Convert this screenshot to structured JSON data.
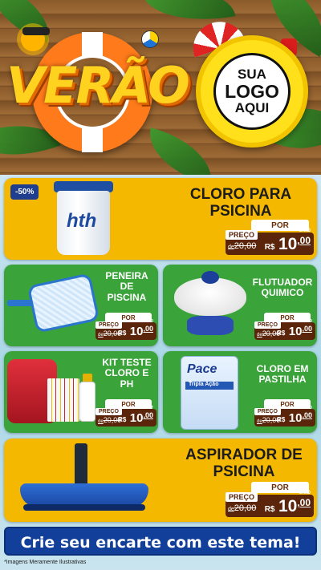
{
  "header": {
    "title": "VERÃO",
    "logo_line1": "SUA",
    "logo_line2": "LOGO",
    "logo_line3": "AQUI"
  },
  "products": [
    {
      "name_line1": "CLORO PARA",
      "name_line2": "PSICINA",
      "badge": "-50%",
      "por_label": "POR",
      "preco_label": "PREÇO",
      "old_prefix": "de",
      "old_price": "20,00",
      "currency": "R$",
      "price_int": "10",
      "price_dec": ",00",
      "unit": "UNID"
    },
    {
      "name_line1": "PENEIRA",
      "name_line2": "DE",
      "name_line3": "PISCINA",
      "por_label": "POR",
      "preco_label": "PREÇO",
      "old_prefix": "de",
      "old_price": "20,00",
      "currency": "R$",
      "price_int": "10",
      "price_dec": ",00",
      "unit": "UNID"
    },
    {
      "name_line1": "FLUTUADOR",
      "name_line2": "QUIMICO",
      "por_label": "POR",
      "preco_label": "PREÇO",
      "old_prefix": "de",
      "old_price": "20,00",
      "currency": "R$",
      "price_int": "10",
      "price_dec": ",00",
      "unit": "UNID"
    },
    {
      "name_line1": "KIT TESTE",
      "name_line2": "CLORO E",
      "name_line3": "PH",
      "por_label": "POR",
      "preco_label": "PREÇO",
      "old_prefix": "de",
      "old_price": "20,00",
      "currency": "R$",
      "price_int": "10",
      "price_dec": ",00",
      "unit": "KIT"
    },
    {
      "name_line1": "CLORO EM",
      "name_line2": "PASTILHA",
      "brand": "Pace",
      "brand_sub": "Tripla Ação",
      "por_label": "POR",
      "preco_label": "PREÇO",
      "old_prefix": "de",
      "old_price": "20,00",
      "currency": "R$",
      "price_int": "10",
      "price_dec": ",00",
      "unit": "UNID"
    },
    {
      "name_line1": "ASPIRADOR DE",
      "name_line2": "PSICINA",
      "por_label": "POR",
      "preco_label": "PREÇO",
      "old_prefix": "de",
      "old_price": "20,00",
      "currency": "R$",
      "price_int": "10",
      "price_dec": ",00",
      "unit": "UNID"
    }
  ],
  "bucket_brand": "hth",
  "cta": "Crie seu encarte com este tema!",
  "footnote": "*Imagens Meramente Ilustrativas",
  "colors": {
    "yellow_card": "#f5b800",
    "green_card": "#3aa33a",
    "price_box": "#5a250a",
    "cta_blue": "#123f9a"
  }
}
